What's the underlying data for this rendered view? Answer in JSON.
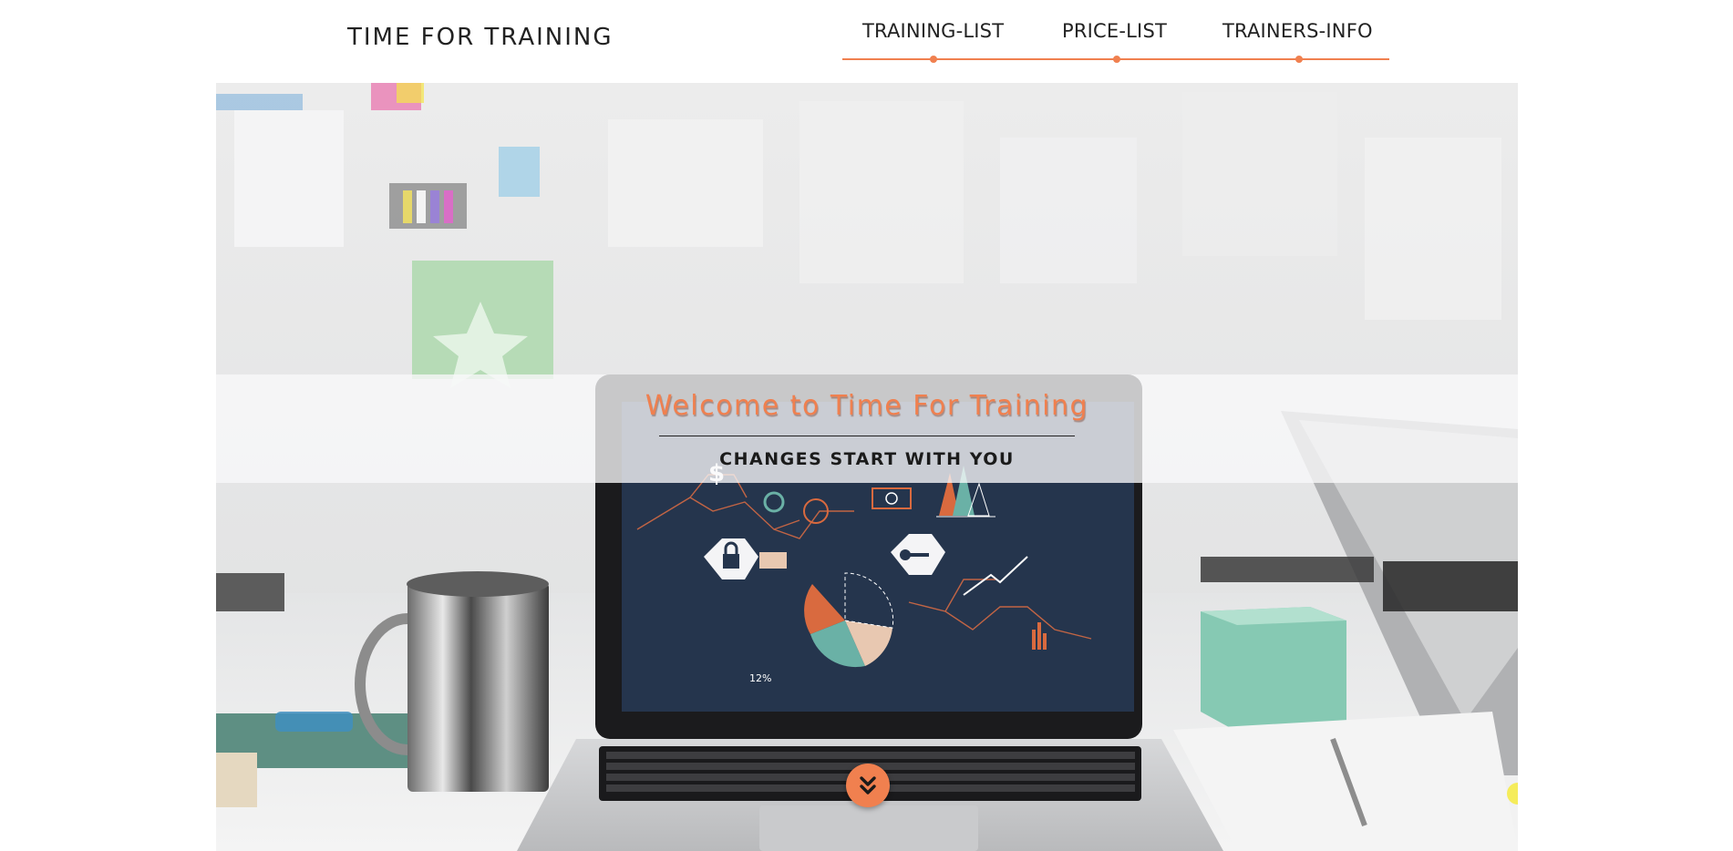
{
  "header": {
    "brand": "TIME FOR TRAINING",
    "nav": [
      {
        "label": "TRAINING-LIST"
      },
      {
        "label": "PRICE-LIST"
      },
      {
        "label": "TRAINERS-INFO"
      }
    ]
  },
  "hero": {
    "title": "Welcome to Time For Training",
    "subtitle": "CHANGES START WITH YOU",
    "scroll_icon": "double-chevron-down-icon",
    "screen_labels": [
      "$",
      "12%"
    ]
  },
  "colors": {
    "accent": "#f0804f",
    "text": "#222222",
    "laptop_screen": "#25354d",
    "mug_teal": "#5fb7a3"
  }
}
